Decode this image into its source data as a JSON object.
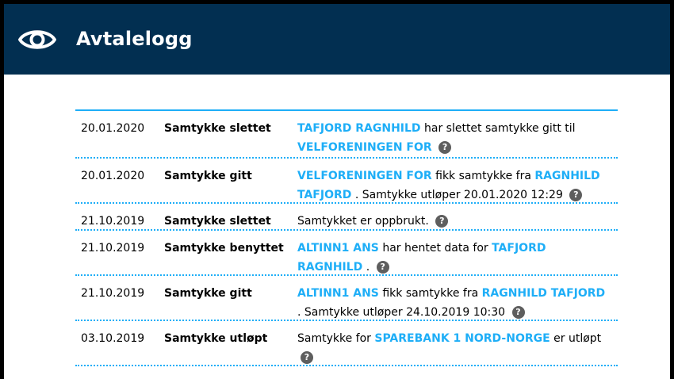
{
  "header": {
    "title": "Avtalelogg",
    "icon": "eye-icon"
  },
  "colors": {
    "header_bg": "#022f51",
    "accent": "#1eaef7",
    "help_bg": "#5e5e5e"
  },
  "help_glyph": "?",
  "entries": [
    {
      "date": "20.01.2020",
      "type": "Samtykke slettet",
      "desc": [
        {
          "t": "TAFJORD RAGNHILD",
          "link": true
        },
        {
          "t": " har slettet samtykke gitt til "
        },
        {
          "t": "VELFORENINGEN FOR",
          "link": true
        },
        {
          "t": " "
        }
      ]
    },
    {
      "date": "20.01.2020",
      "type": "Samtykke gitt",
      "desc": [
        {
          "t": "VELFORENINGEN FOR",
          "link": true
        },
        {
          "t": " fikk samtykke fra "
        },
        {
          "t": "RAGNHILD TAFJORD",
          "link": true
        },
        {
          "t": " . Samtykke utløper 20.01.2020 12:29 "
        }
      ]
    },
    {
      "date": "21.10.2019",
      "type": "Samtykke slettet",
      "desc": [
        {
          "t": "Samtykket er oppbrukt. "
        }
      ]
    },
    {
      "date": "21.10.2019",
      "type": "Samtykke benyttet",
      "desc": [
        {
          "t": "ALTINN1 ANS",
          "link": true
        },
        {
          "t": " har hentet data for "
        },
        {
          "t": "TAFJORD RAGNHILD",
          "link": true
        },
        {
          "t": " . "
        }
      ]
    },
    {
      "date": "21.10.2019",
      "type": "Samtykke gitt",
      "desc": [
        {
          "t": "ALTINN1 ANS",
          "link": true
        },
        {
          "t": " fikk samtykke fra "
        },
        {
          "t": "RAGNHILD TAFJORD",
          "link": true
        },
        {
          "t": " . Samtykke utløper 24.10.2019 10:30 "
        }
      ]
    },
    {
      "date": "03.10.2019",
      "type": "Samtykke utløpt",
      "desc": [
        {
          "t": "Samtykke for "
        },
        {
          "t": "SPAREBANK 1 NORD-NORGE",
          "link": true
        },
        {
          "t": " er utløpt "
        }
      ]
    }
  ]
}
